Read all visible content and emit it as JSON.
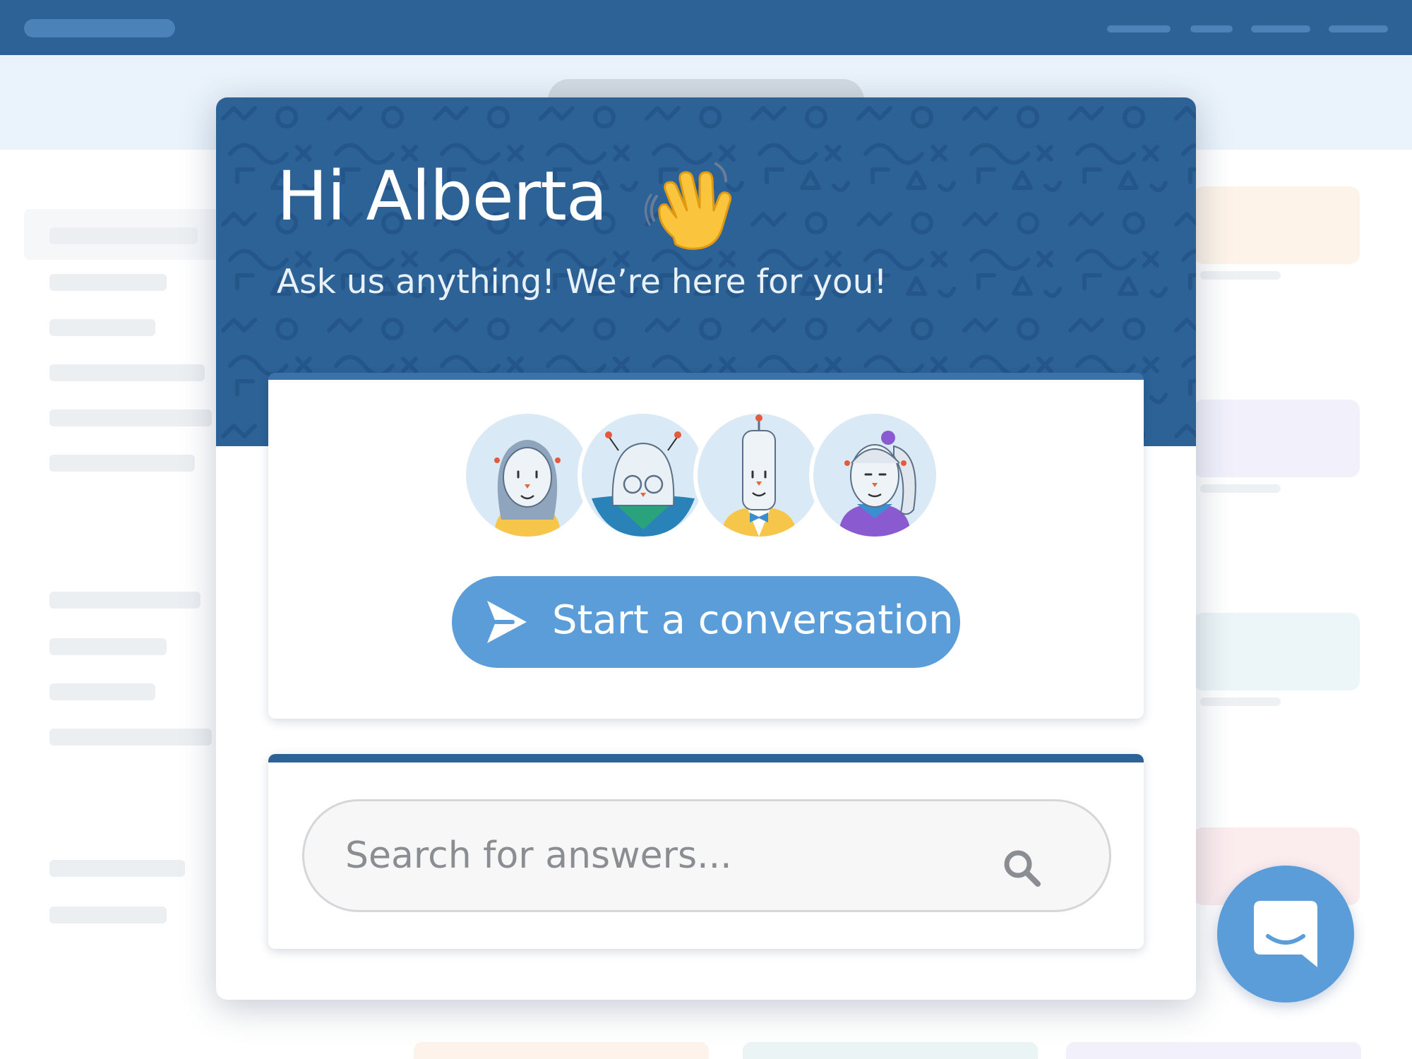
{
  "messenger": {
    "greeting": "Hi Alberta",
    "greeting_emoji": "waving-hand",
    "tagline": "Ask us anything! We’re here for you!",
    "team_avatars": [
      "support-agent-1",
      "support-agent-2",
      "support-agent-3",
      "support-agent-4"
    ],
    "start_button_label": "Start a conversation",
    "search_placeholder": "Search for answers..."
  },
  "launcher": {
    "icon": "chat-bubble-smile-icon"
  },
  "colors": {
    "brand_dark": "#2c6296",
    "brand_light": "#5a9dd9",
    "hero_band": "#eaf3fb"
  }
}
